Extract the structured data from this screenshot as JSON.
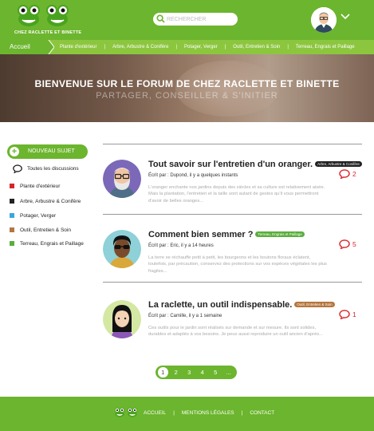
{
  "header": {
    "logo_text": "CHEZ RACLETTE ET BINETTE",
    "search_placeholder": "RECHERCHER"
  },
  "nav": {
    "home": "Accueil",
    "items": [
      "Plante d'extérieur",
      "Arbre, Arbustre & Conifère",
      "Potager, Verger",
      "Outil, Entretien & Soin",
      "Terreau, Engrais et Paillage"
    ]
  },
  "hero": {
    "title": "BIENVENUE SUR LE FORUM DE CHEZ RACLETTE ET BINETTE",
    "subtitle": "PARTAGER, CONSEILLER & S'INITIER"
  },
  "sidebar": {
    "new_topic": "NOUVEAU SUJET",
    "all_topics": "Toutes les discussions",
    "categories": [
      {
        "label": "Plante d'extérieur",
        "color": "#d8232a"
      },
      {
        "label": "Arbre, Arbustre & Conifère",
        "color": "#222222"
      },
      {
        "label": "Potager, Verger",
        "color": "#3aa6dd"
      },
      {
        "label": "Outil, Entretien & Soin",
        "color": "#b5763f"
      },
      {
        "label": "Terreau, Engrais et Paillage",
        "color": "#5aae3c"
      }
    ]
  },
  "posts": [
    {
      "title": "Tout savoir sur l'entretien d'un oranger.",
      "badge": "Arbre, Arbustre & Conifère",
      "badge_color": "#222222",
      "meta": "Écrit par : Dupond, il y a quelques instants",
      "excerpt": "L'oranger enchante nos jardins depuis des siècles et sa culture est relativement aisée. Mais la plantation, l'entretien et la taille sont autant de gestes qu'il vous permettront d'avoir de belles oranges...",
      "comments": "2"
    },
    {
      "title": "Comment bien semmer ?",
      "badge": "Terreau, Engrais et Paillage",
      "badge_color": "#5aae3c",
      "meta": "Écrit par : Eric, il y a 14 heures",
      "excerpt": "La terre se réchauffe petit à petit, les bourgeons et les boutons floraux éclatent, toutefois, par précaution, conservez des protections sur vos espèces végétales les plus fragiles...",
      "comments": "5"
    },
    {
      "title": "La raclette, un outil indispensable.",
      "badge": "Outil, Entretien & Soin",
      "badge_color": "#b5763f",
      "meta": "Écrit par : Camille, il y a 1 semaine",
      "excerpt": "Ces outils pour le jardin sont réalisés sur demande et sur mesure. Ils sont solides, durables et adaptés à vos besoins. Je peux aussi reproduire un outil ancien d'après...",
      "comments": "1"
    }
  ],
  "pagination": {
    "pages": [
      "1",
      "2",
      "3",
      "4",
      "5",
      "..."
    ],
    "current": "1"
  },
  "footer": {
    "links": [
      "ACCUEIL",
      "MENTIONS LÉGALES",
      "CONTACT"
    ]
  },
  "colors": {
    "brand_green": "#6cb52e",
    "nav_green": "#8cc63f",
    "comment_red": "#d8232a"
  }
}
